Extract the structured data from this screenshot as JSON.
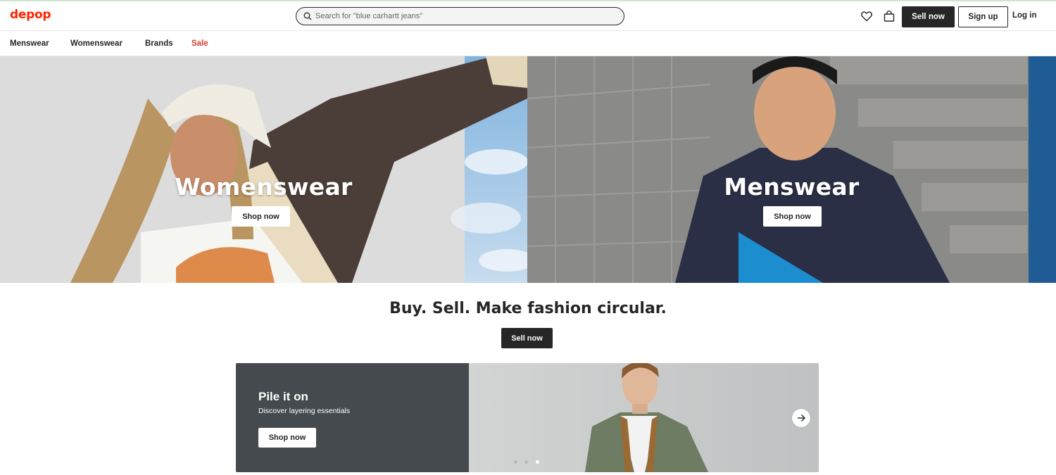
{
  "header": {
    "logo": "depop",
    "search_placeholder": "Search for \"blue carhartt jeans\"",
    "sell_now": "Sell now",
    "sign_up": "Sign up",
    "log_in": "Log in",
    "icons": [
      "search-icon",
      "heart-icon",
      "bag-icon"
    ]
  },
  "nav": {
    "items": [
      "Menswear",
      "Womenswear",
      "Brands",
      "Sale"
    ],
    "sale_color": "#d43b2e"
  },
  "hero": {
    "left": {
      "title": "Womenswear",
      "button": "Shop now"
    },
    "right": {
      "title": "Menswear",
      "button": "Shop now"
    }
  },
  "middle": {
    "tagline": "Buy. Sell. Make fashion circular.",
    "button": "Sell now"
  },
  "promo": {
    "title": "Pile it on",
    "subtitle": "Discover layering essentials",
    "button": "Shop now",
    "slides_total": 3,
    "active_slide": 3,
    "arrow_icon": "arrow-right-icon"
  },
  "colors": {
    "brand": "#ff2300",
    "dark": "#262626",
    "promo_panel": "#444a4e"
  }
}
